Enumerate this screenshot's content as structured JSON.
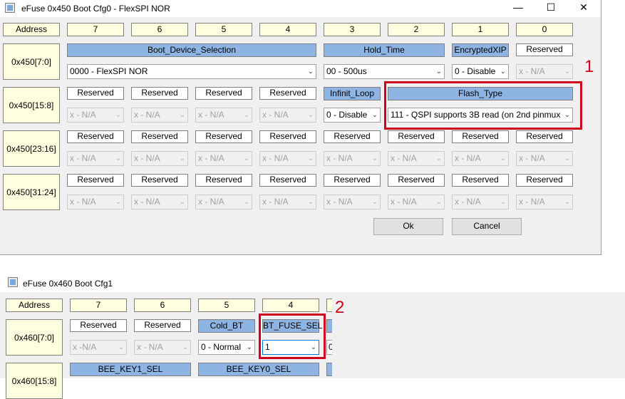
{
  "win1": {
    "title": "eFuse 0x450 Boot Cfg0 - FlexSPI NOR",
    "minimize": "—",
    "maximize": "☐",
    "close": "✕",
    "address_header": "Address",
    "bit_headers": [
      "7",
      "6",
      "5",
      "4",
      "3",
      "2",
      "1",
      "0"
    ],
    "rows": {
      "r0": {
        "address": "0x450[7:0]",
        "fields": {
          "boot_device_selection": "Boot_Device_Selection",
          "hold_time": "Hold_Time",
          "encrypted_xip": "EncryptedXIP",
          "reserved0": "Reserved"
        },
        "values": {
          "boot_device_selection": "0000 - FlexSPI NOR",
          "hold_time": "00 - 500us",
          "encrypted_xip": "0 - Disable",
          "reserved0": "x - N/A"
        }
      },
      "r1": {
        "address": "0x450[15:8]",
        "fields": {
          "b7": "Reserved",
          "b6": "Reserved",
          "b5": "Reserved",
          "b4": "Reserved",
          "infinit_loop": "Infinit_Loop",
          "flash_type": "Flash_Type"
        },
        "values": {
          "b7": "x - N/A",
          "b6": "x - N/A",
          "b5": "x - N/A",
          "b4": "x - N/A",
          "infinit_loop": "0 - Disable",
          "flash_type": "111 - QSPI supports 3B read (on 2nd pinmux"
        }
      },
      "r2": {
        "address": "0x450[23:16]",
        "fields": [
          "Reserved",
          "Reserved",
          "Reserved",
          "Reserved",
          "Reserved",
          "Reserved",
          "Reserved",
          "Reserved"
        ],
        "values": [
          "x - N/A",
          "x - N/A",
          "x - N/A",
          "x - N/A",
          "x - N/A",
          "x - N/A",
          "x - N/A",
          "x - N/A"
        ]
      },
      "r3": {
        "address": "0x450[31:24]",
        "fields": [
          "Reserved",
          "Reserved",
          "Reserved",
          "Reserved",
          "Reserved",
          "Reserved",
          "Reserved",
          "Reserved"
        ],
        "values": [
          "x - N/A",
          "x - N/A",
          "x - N/A",
          "x - N/A",
          "x - N/A",
          "x - N/A",
          "x - N/A",
          "x - N/A"
        ]
      }
    },
    "ok_label": "Ok",
    "cancel_label": "Cancel"
  },
  "win2": {
    "title": "eFuse 0x460 Boot Cfg1",
    "address_header": "Address",
    "bit_headers": [
      "7",
      "6",
      "5",
      "4"
    ],
    "row0": {
      "address": "0x460[7:0]",
      "fields": {
        "b7": "Reserved",
        "b6": "Reserved",
        "cold_bt": "Cold_BT",
        "bt_fuse_sel": "BT_FUSE_SEL"
      },
      "values": {
        "b7": "x -N/A",
        "b6": "x - N/A",
        "cold_bt": "0 - Normal",
        "bt_fuse_sel": "1",
        "partial": "0"
      }
    },
    "row1": {
      "address": "0x460[15:8]",
      "fields": {
        "bee_key1_sel": "BEE_KEY1_SEL",
        "bee_key0_sel": "BEE_KEY0_SEL"
      }
    }
  },
  "annotations": {
    "label1": "1",
    "label2": "2"
  },
  "colors": {
    "header_bg": "#ffffe0",
    "field_bg": "#8db4e2",
    "highlight": "#d0021b"
  }
}
